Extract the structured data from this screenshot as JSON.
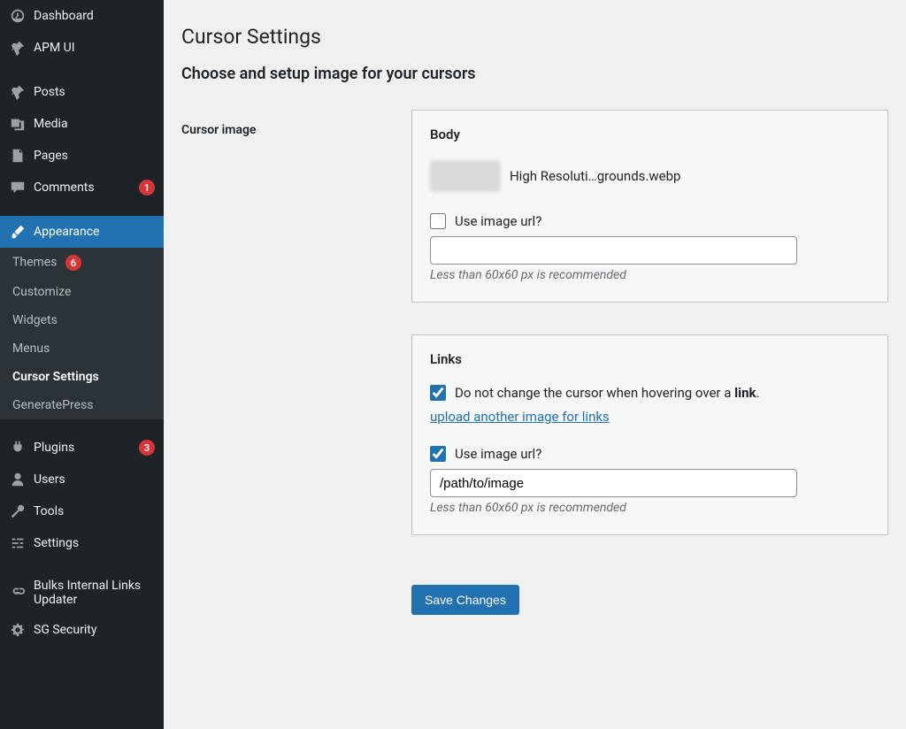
{
  "sidebar": {
    "dashboard": "Dashboard",
    "apm_ui": "APM UI",
    "posts": "Posts",
    "media": "Media",
    "pages": "Pages",
    "comments": "Comments",
    "comments_badge": "1",
    "appearance": "Appearance",
    "appearance_sub": {
      "themes": "Themes",
      "themes_badge": "6",
      "customize": "Customize",
      "widgets": "Widgets",
      "menus": "Menus",
      "cursor_settings": "Cursor Settings",
      "generatepress": "GeneratePress"
    },
    "plugins": "Plugins",
    "plugins_badge": "3",
    "users": "Users",
    "tools": "Tools",
    "settings": "Settings",
    "bulks_internal": "Bulks Internal Links Updater",
    "sg_security": "SG Security"
  },
  "main": {
    "title": "Cursor Settings",
    "subtitle": "Choose and setup image for your cursors",
    "cursor_image_label": "Cursor image",
    "save_button": "Save Changes"
  },
  "body_panel": {
    "title": "Body",
    "thumb_filename": "High Resoluti…grounds.webp",
    "use_url_label": "Use image url?",
    "use_url_checked": false,
    "url_value": "",
    "hint": "Less than 60x60 px is recommended"
  },
  "links_panel": {
    "title": "Links",
    "dont_change_pre": "Do not change the cursor when hovering over a ",
    "dont_change_strong": "link",
    "dont_change_post": ".",
    "dont_change_checked": true,
    "upload_link": "upload another image for links",
    "use_url_label": "Use image url?",
    "use_url_checked": true,
    "url_value": "/path/to/image",
    "hint": "Less than 60x60 px is recommended"
  }
}
